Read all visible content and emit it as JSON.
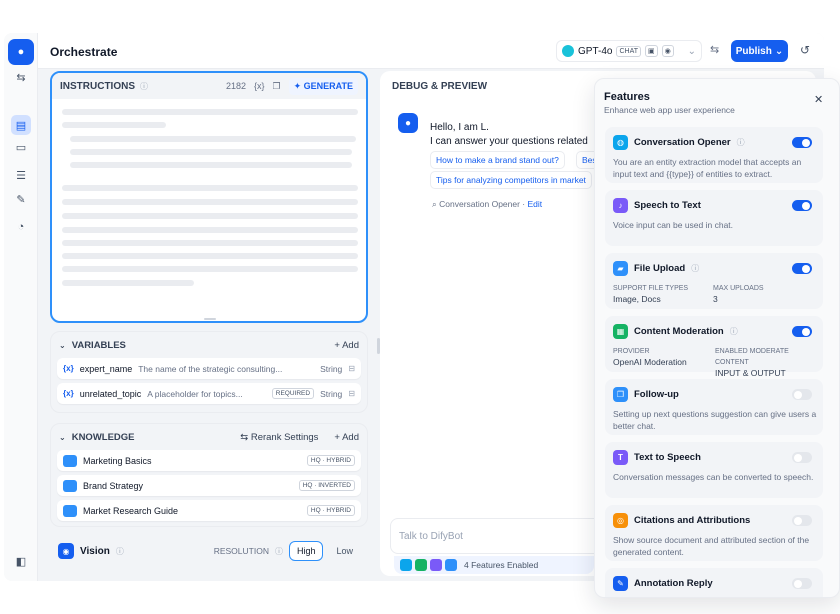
{
  "app": {
    "title": "Orchestrate"
  },
  "model": {
    "name": "GPT-4o",
    "mode": "CHAT"
  },
  "publish_label": "Publish",
  "instructions": {
    "label": "INSTRUCTIONS",
    "count": "2182",
    "var_token": "{x}",
    "generate_label": "GENERATE"
  },
  "variables": {
    "label": "VARIABLES",
    "add_label": "Add",
    "items": [
      {
        "token": "{x}",
        "name": "expert_name",
        "desc": "The name of the strategic consulting...",
        "badge": "",
        "type": "String"
      },
      {
        "token": "{x}",
        "name": "unrelated_topic",
        "desc": "A placeholder for topics...",
        "badge": "REQUIRED",
        "type": "String"
      }
    ]
  },
  "knowledge": {
    "label": "KNOWLEDGE",
    "rerank_label": "Rerank Settings",
    "add_label": "Add",
    "items": [
      {
        "name": "Marketing Basics",
        "tag": "HQ · HYBRID"
      },
      {
        "name": "Brand Strategy",
        "tag": "HQ · INVERTED"
      },
      {
        "name": "Market Research Guide",
        "tag": "HQ · HYBRID"
      }
    ]
  },
  "vision": {
    "label": "Vision",
    "resolution_label": "RESOLUTION",
    "high": "High",
    "low": "Low"
  },
  "debug": {
    "title": "DEBUG & PREVIEW",
    "greeting_1": "Hello, I am L.",
    "greeting_2": "I can answer your questions related",
    "suggestions": [
      "How to make a brand stand out?",
      "Bes",
      "Tips for analyzing competitors in market"
    ],
    "opener_note": "Conversation Opener",
    "edit_label": "Edit",
    "input_placeholder": "Talk to DifyBot",
    "features_enabled": "4 Features Enabled"
  },
  "features_panel": {
    "title": "Features",
    "subtitle": "Enhance web app user experience",
    "items": [
      {
        "name": "Conversation Opener",
        "desc": "You are an entity extraction model that accepts an input text and {{type}} of entities to extract.",
        "enabled": true,
        "color": "#0ba5ec"
      },
      {
        "name": "Speech to Text",
        "desc": "Voice input can be used in chat.",
        "enabled": true,
        "color": "#7a5af8"
      },
      {
        "name": "File Upload",
        "k1": "SUPPORT FILE TYPES",
        "v1": "Image, Docs",
        "k2": "MAX UPLOADS",
        "v2": "3",
        "enabled": true,
        "color": "#2e90fa"
      },
      {
        "name": "Content Moderation",
        "k1": "PROVIDER",
        "v1": "OpenAI Moderation",
        "k2": "ENABLED MODERATE CONTENT",
        "v2": "INPUT & OUTPUT",
        "enabled": true,
        "color": "#16b364"
      },
      {
        "name": "Follow-up",
        "desc": "Setting up next questions suggestion can give users a better chat.",
        "enabled": false,
        "color": "#2e90fa"
      },
      {
        "name": "Text to Speech",
        "desc": "Conversation messages can be converted to speech.",
        "enabled": false,
        "color": "#7a5af8"
      },
      {
        "name": "Citations and Attributions",
        "desc": "Show source document and attributed section of the generated content.",
        "enabled": false,
        "color": "#f79009"
      },
      {
        "name": "Annotation Reply",
        "desc": "",
        "enabled": false,
        "color": "#155eef"
      }
    ]
  }
}
